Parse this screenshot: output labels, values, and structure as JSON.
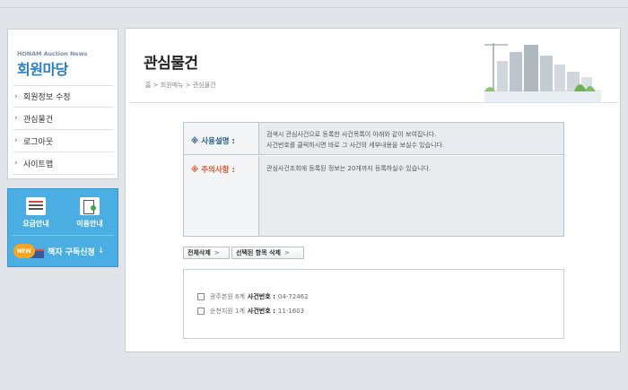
{
  "sidebar": {
    "brand_small": "HONAM Auction News",
    "brand_title": "회원마당",
    "menu": [
      {
        "label": "회원정보 수정"
      },
      {
        "label": "관심물건"
      },
      {
        "label": "로그아웃"
      },
      {
        "label": "사이트맵"
      }
    ],
    "quick": {
      "price_label": "요금안내",
      "guide_label": "이용안내",
      "new_badge": "NEW",
      "subscribe_label": "책자 구독신청",
      "subscribe_icon": "↓"
    }
  },
  "main": {
    "title": "관심물건",
    "breadcrumb": "홈 > 회원메뉴 > 관심물건",
    "usage": {
      "label": "※ 사용설명 :",
      "line1": "검색시 관심사건으로 등록한 사건목록이 아래와 같이 보여집니다.",
      "line2": "사건번호를 클릭하시면 바로 그 사건의 세부내용을 보실수 있습니다."
    },
    "notice": {
      "label": "※ 주의사항 :",
      "line1": "관심사건조회에 등록된 정보는 20개까지 등록하실수 있습니다."
    },
    "buttons": {
      "delete_all": "전체삭제",
      "delete_selected": "선택된 항목 삭제",
      "chevron": ">"
    },
    "items": [
      {
        "court": "광주본원 6계",
        "case_label": "사건번호 :",
        "case_no": "04-72462"
      },
      {
        "court": "순천지원 1계",
        "case_label": "사건번호 :",
        "case_no": "11-1603"
      }
    ]
  },
  "colors": {
    "accent": "#2c7fc2",
    "quick_bg": "#4aaee3",
    "notice_red": "#e2572b"
  }
}
